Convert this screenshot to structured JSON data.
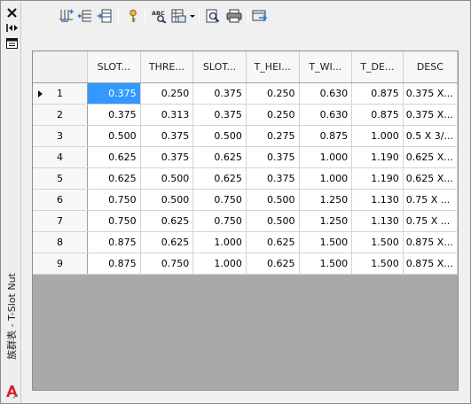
{
  "window": {
    "title": "族群表 - T-Slot Nut"
  },
  "strip_icons": [
    "close-icon",
    "auto-hide-icon",
    "properties-icon"
  ],
  "toolbar": {
    "groups": [
      [
        "insert-row-icon",
        "insert-column-icon",
        "edit-column-icon"
      ],
      [
        "key-icon"
      ],
      [
        "spellcheck-icon",
        "list-dropdown-icon"
      ],
      [
        "print-preview-icon",
        "print-icon"
      ],
      [
        "export-icon"
      ]
    ]
  },
  "table": {
    "columns": [
      "SLOT...",
      "THRE...",
      "SLOT...",
      "T_HEI...",
      "T_WI...",
      "T_DE...",
      "DESC"
    ],
    "selected_row": 0,
    "selected_col": 0,
    "rows": [
      {
        "num": "1",
        "cells": [
          "0.375",
          "0.250",
          "0.375",
          "0.250",
          "0.630",
          "0.875",
          "0.375 X..."
        ]
      },
      {
        "num": "2",
        "cells": [
          "0.375",
          "0.313",
          "0.375",
          "0.250",
          "0.630",
          "0.875",
          "0.375 X..."
        ]
      },
      {
        "num": "3",
        "cells": [
          "0.500",
          "0.375",
          "0.500",
          "0.275",
          "0.875",
          "1.000",
          "0.5 X 3/..."
        ]
      },
      {
        "num": "4",
        "cells": [
          "0.625",
          "0.375",
          "0.625",
          "0.375",
          "1.000",
          "1.190",
          "0.625 X..."
        ]
      },
      {
        "num": "5",
        "cells": [
          "0.625",
          "0.500",
          "0.625",
          "0.375",
          "1.000",
          "1.190",
          "0.625 X..."
        ]
      },
      {
        "num": "6",
        "cells": [
          "0.750",
          "0.500",
          "0.750",
          "0.500",
          "1.250",
          "1.130",
          "0.75 X ..."
        ]
      },
      {
        "num": "7",
        "cells": [
          "0.750",
          "0.625",
          "0.750",
          "0.500",
          "1.250",
          "1.130",
          "0.75 X ..."
        ]
      },
      {
        "num": "8",
        "cells": [
          "0.875",
          "0.625",
          "1.000",
          "0.625",
          "1.500",
          "1.500",
          "0.875 X..."
        ]
      },
      {
        "num": "9",
        "cells": [
          "0.875",
          "0.750",
          "1.000",
          "0.625",
          "1.500",
          "1.500",
          "0.875 X..."
        ]
      }
    ]
  },
  "colors": {
    "selection": "#3399ff",
    "grid_empty": "#a9a9a9",
    "header_bg": "#f7f7f7"
  }
}
